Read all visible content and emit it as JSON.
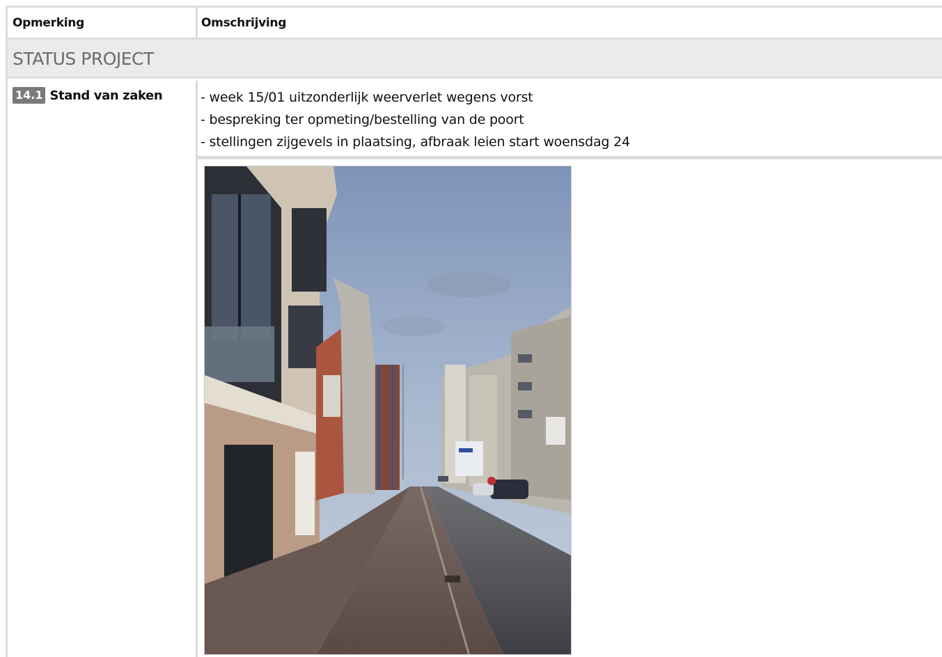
{
  "table": {
    "headers": {
      "col1": "Opmerking",
      "col2": "Omschrijving"
    },
    "section": {
      "title": "STATUS PROJECT"
    },
    "item": {
      "number": "14.1",
      "title": "Stand van zaken",
      "lines": [
        "- week 15/01 uitzonderlijk weerverlet wegens vorst",
        "- bespreking ter opmeting/bestelling van de poort",
        "- stellingen zijgevels in plaatsing, afbraak leien start woensdag 24"
      ],
      "photo": {
        "subject": "street-photo"
      }
    }
  },
  "colors": {
    "border": "#dcdcdc",
    "section_bg": "#ebebeb",
    "section_text": "#6b6b6b",
    "badge_bg": "#7a7a7a"
  }
}
